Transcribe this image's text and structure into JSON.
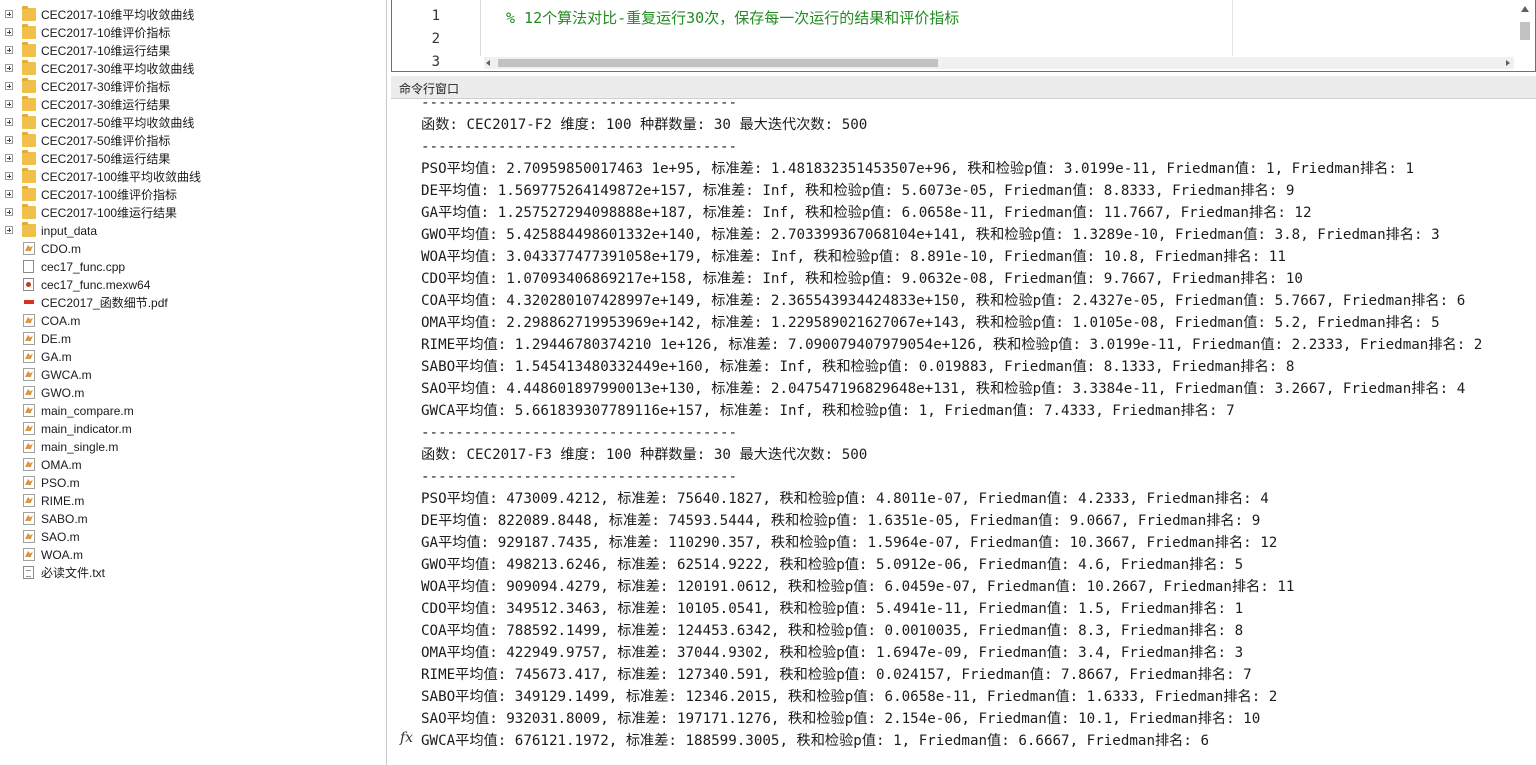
{
  "file_browser": {
    "items": [
      {
        "name": "CEC2017-10维平均收敛曲线",
        "type": "folder"
      },
      {
        "name": "CEC2017-10维评价指标",
        "type": "folder"
      },
      {
        "name": "CEC2017-10维运行结果",
        "type": "folder"
      },
      {
        "name": "CEC2017-30维平均收敛曲线",
        "type": "folder"
      },
      {
        "name": "CEC2017-30维评价指标",
        "type": "folder"
      },
      {
        "name": "CEC2017-30维运行结果",
        "type": "folder"
      },
      {
        "name": "CEC2017-50维平均收敛曲线",
        "type": "folder"
      },
      {
        "name": "CEC2017-50维评价指标",
        "type": "folder"
      },
      {
        "name": "CEC2017-50维运行结果",
        "type": "folder"
      },
      {
        "name": "CEC2017-100维平均收敛曲线",
        "type": "folder"
      },
      {
        "name": "CEC2017-100维评价指标",
        "type": "folder"
      },
      {
        "name": "CEC2017-100维运行结果",
        "type": "folder"
      },
      {
        "name": "input_data",
        "type": "folder"
      },
      {
        "name": "CDO.m",
        "type": "m"
      },
      {
        "name": "cec17_func.cpp",
        "type": "cpp"
      },
      {
        "name": "cec17_func.mexw64",
        "type": "mex"
      },
      {
        "name": "CEC2017_函数细节.pdf",
        "type": "pdf"
      },
      {
        "name": "COA.m",
        "type": "m"
      },
      {
        "name": "DE.m",
        "type": "m"
      },
      {
        "name": "GA.m",
        "type": "m"
      },
      {
        "name": "GWCA.m",
        "type": "m"
      },
      {
        "name": "GWO.m",
        "type": "m"
      },
      {
        "name": "main_compare.m",
        "type": "m"
      },
      {
        "name": "main_indicator.m",
        "type": "m"
      },
      {
        "name": "main_single.m",
        "type": "m"
      },
      {
        "name": "OMA.m",
        "type": "m"
      },
      {
        "name": "PSO.m",
        "type": "m"
      },
      {
        "name": "RIME.m",
        "type": "m"
      },
      {
        "name": "SABO.m",
        "type": "m"
      },
      {
        "name": "SAO.m",
        "type": "m"
      },
      {
        "name": "WOA.m",
        "type": "m"
      },
      {
        "name": "必读文件.txt",
        "type": "txt"
      }
    ]
  },
  "editor": {
    "line_numbers": [
      "1",
      "2",
      "3"
    ],
    "code_line_1": "% 12个算法对比-重复运行30次，保存每一次运行的结果和评价指标"
  },
  "command_window": {
    "title": "命令行窗口",
    "prompt_symbol": "fx",
    "lines": [
      "-------------------------------------",
      "函数: CEC2017-F2 维度: 100 种群数量: 30 最大迭代次数: 500",
      "-------------------------------------",
      "PSO平均值: 2.70959850017463 1e+95, 标准差: 1.481832351453507e+96, 秩和检验p值: 3.0199e-11, Friedman值: 1, Friedman排名: 1",
      "DE平均值: 1.569775264149872e+157, 标准差: Inf, 秩和检验p值: 5.6073e-05, Friedman值: 8.8333, Friedman排名: 9",
      "GA平均值: 1.257527294098888e+187, 标准差: Inf, 秩和检验p值: 6.0658e-11, Friedman值: 11.7667, Friedman排名: 12",
      "GWO平均值: 5.425884498601332e+140, 标准差: 2.703399367068104e+141, 秩和检验p值: 1.3289e-10, Friedman值: 3.8, Friedman排名: 3",
      "WOA平均值: 3.043377477391058e+179, 标准差: Inf, 秩和检验p值: 8.891e-10, Friedman值: 10.8, Friedman排名: 11",
      "CDO平均值: 1.07093406869217e+158, 标准差: Inf, 秩和检验p值: 9.0632e-08, Friedman值: 9.7667, Friedman排名: 10",
      "COA平均值: 4.320280107428997e+149, 标准差: 2.365543934424833e+150, 秩和检验p值: 2.4327e-05, Friedman值: 5.7667, Friedman排名: 6",
      "OMA平均值: 2.298862719953969e+142, 标准差: 1.229589021627067e+143, 秩和检验p值: 1.0105e-08, Friedman值: 5.2, Friedman排名: 5",
      "RIME平均值: 1.29446780374210 1e+126, 标准差: 7.090079407979054e+126, 秩和检验p值: 3.0199e-11, Friedman值: 2.2333, Friedman排名: 2",
      "SABO平均值: 1.545413480332449e+160, 标准差: Inf, 秩和检验p值: 0.019883, Friedman值: 8.1333, Friedman排名: 8",
      "SAO平均值: 4.448601897990013e+130, 标准差: 2.047547196829648e+131, 秩和检验p值: 3.3384e-11, Friedman值: 3.2667, Friedman排名: 4",
      "GWCA平均值: 5.661839307789116e+157, 标准差: Inf, 秩和检验p值: 1, Friedman值: 7.4333, Friedman排名: 7",
      "-------------------------------------",
      "函数: CEC2017-F3 维度: 100 种群数量: 30 最大迭代次数: 500",
      "-------------------------------------",
      "PSO平均值: 473009.4212, 标准差: 75640.1827, 秩和检验p值: 4.8011e-07, Friedman值: 4.2333, Friedman排名: 4",
      "DE平均值: 822089.8448, 标准差: 74593.5444, 秩和检验p值: 1.6351e-05, Friedman值: 9.0667, Friedman排名: 9",
      "GA平均值: 929187.7435, 标准差: 110290.357, 秩和检验p值: 1.5964e-07, Friedman值: 10.3667, Friedman排名: 12",
      "GWO平均值: 498213.6246, 标准差: 62514.9222, 秩和检验p值: 5.0912e-06, Friedman值: 4.6, Friedman排名: 5",
      "WOA平均值: 909094.4279, 标准差: 120191.0612, 秩和检验p值: 6.0459e-07, Friedman值: 10.2667, Friedman排名: 11",
      "CDO平均值: 349512.3463, 标准差: 10105.0541, 秩和检验p值: 5.4941e-11, Friedman值: 1.5, Friedman排名: 1",
      "COA平均值: 788592.1499, 标准差: 124453.6342, 秩和检验p值: 0.0010035, Friedman值: 8.3, Friedman排名: 8",
      "OMA平均值: 422949.9757, 标准差: 37044.9302, 秩和检验p值: 1.6947e-09, Friedman值: 3.4, Friedman排名: 3",
      "RIME平均值: 745673.417, 标准差: 127340.591, 秩和检验p值: 0.024157, Friedman值: 7.8667, Friedman排名: 7",
      "SABO平均值: 349129.1499, 标准差: 12346.2015, 秩和检验p值: 6.0658e-11, Friedman值: 1.6333, Friedman排名: 2",
      "SAO平均值: 932031.8009, 标准差: 197171.1276, 秩和检验p值: 2.154e-06, Friedman值: 10.1, Friedman排名: 10",
      "GWCA平均值: 676121.1972, 标准差: 188599.3005, 秩和检验p值: 1, Friedman值: 6.6667, Friedman排名: 6"
    ]
  }
}
